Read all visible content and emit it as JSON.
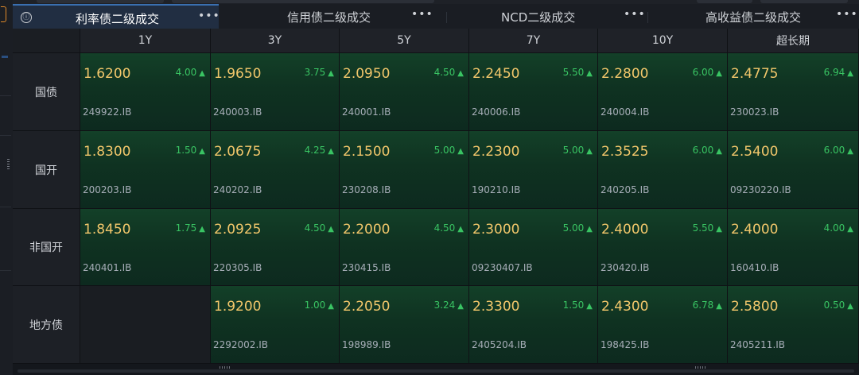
{
  "tabs": [
    {
      "label": "利率债二级成交",
      "menu": "•••"
    },
    {
      "label": "信用债二级成交",
      "menu": "•••"
    },
    {
      "label": "NCD二级成交",
      "menu": "•••"
    },
    {
      "label": "高收益债二级成交",
      "menu": "•••"
    }
  ],
  "info_icon": "ⓘ",
  "columns": [
    "1Y",
    "3Y",
    "5Y",
    "7Y",
    "10Y",
    "超长期"
  ],
  "rows": [
    {
      "label": "国债",
      "cells": [
        {
          "rate": "1.6200",
          "change": "4.00",
          "code": "249922.IB"
        },
        {
          "rate": "1.9650",
          "change": "3.75",
          "code": "240003.IB"
        },
        {
          "rate": "2.0950",
          "change": "4.50",
          "code": "240001.IB"
        },
        {
          "rate": "2.2450",
          "change": "5.50",
          "code": "240006.IB"
        },
        {
          "rate": "2.2800",
          "change": "6.00",
          "code": "240004.IB"
        },
        {
          "rate": "2.4775",
          "change": "6.94",
          "code": "230023.IB"
        }
      ]
    },
    {
      "label": "国开",
      "cells": [
        {
          "rate": "1.8300",
          "change": "1.50",
          "code": "200203.IB"
        },
        {
          "rate": "2.0675",
          "change": "4.25",
          "code": "240202.IB"
        },
        {
          "rate": "2.1500",
          "change": "5.00",
          "code": "230208.IB"
        },
        {
          "rate": "2.2300",
          "change": "5.00",
          "code": "190210.IB"
        },
        {
          "rate": "2.3525",
          "change": "6.00",
          "code": "240205.IB"
        },
        {
          "rate": "2.5400",
          "change": "6.00",
          "code": "09230220.IB"
        }
      ]
    },
    {
      "label": "非国开",
      "cells": [
        {
          "rate": "1.8450",
          "change": "1.75",
          "code": "240401.IB"
        },
        {
          "rate": "2.0925",
          "change": "4.50",
          "code": "220305.IB"
        },
        {
          "rate": "2.2000",
          "change": "4.50",
          "code": "230415.IB"
        },
        {
          "rate": "2.3000",
          "change": "5.00",
          "code": "09230407.IB"
        },
        {
          "rate": "2.4000",
          "change": "5.50",
          "code": "230420.IB"
        },
        {
          "rate": "2.4000",
          "change": "4.00",
          "code": "160410.IB"
        }
      ]
    },
    {
      "label": "地方债",
      "cells": [
        null,
        {
          "rate": "1.9200",
          "change": "1.00",
          "code": "2292002.IB"
        },
        {
          "rate": "2.2050",
          "change": "3.24",
          "code": "198989.IB"
        },
        {
          "rate": "2.3300",
          "change": "1.50",
          "code": "2405204.IB"
        },
        {
          "rate": "2.4300",
          "change": "6.78",
          "code": "198425.IB"
        },
        {
          "rate": "2.5800",
          "change": "0.50",
          "code": "2405211.IB"
        }
      ]
    }
  ],
  "up_arrow": "▲",
  "colors": {
    "rate": "#f2c76b",
    "up": "#39c463",
    "cell_bg": "#0f3221",
    "active_tab": "#212e42"
  }
}
